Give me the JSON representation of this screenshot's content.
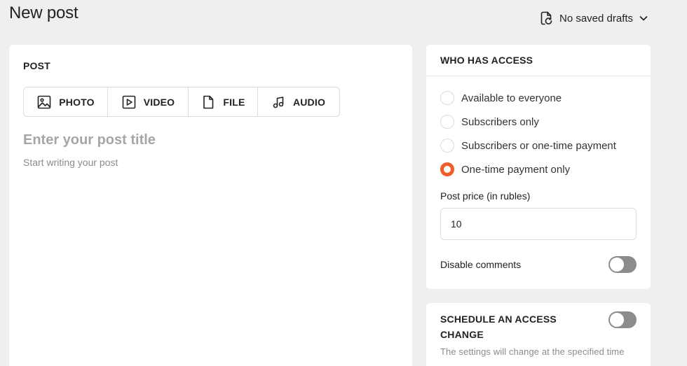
{
  "page": {
    "title": "New post"
  },
  "drafts": {
    "label": "No saved drafts",
    "icon": "document-refresh-icon"
  },
  "editor": {
    "section_label": "POST",
    "media_buttons": [
      {
        "label": "PHOTO",
        "icon": "image-icon"
      },
      {
        "label": "VIDEO",
        "icon": "video-play-icon"
      },
      {
        "label": "FILE",
        "icon": "file-icon"
      },
      {
        "label": "AUDIO",
        "icon": "music-note-icon"
      }
    ],
    "title_placeholder": "Enter your post title",
    "body_placeholder": "Start writing your post"
  },
  "access": {
    "header": "WHO HAS ACCESS",
    "options": [
      {
        "label": "Available to everyone",
        "checked": false
      },
      {
        "label": "Subscribers only",
        "checked": false
      },
      {
        "label": "Subscribers or one-time payment",
        "checked": false
      },
      {
        "label": "One-time payment only",
        "checked": true
      }
    ],
    "price_label": "Post price (in rubles)",
    "price_value": "10",
    "disable_comments_label": "Disable comments",
    "disable_comments_on": false
  },
  "schedule": {
    "title": "SCHEDULE AN ACCESS CHANGE",
    "description": "The settings will change at the specified time",
    "enabled": false
  },
  "colors": {
    "accent": "#ef5d2b",
    "toggle_off": "#8c8c8c",
    "background": "#efefef"
  }
}
